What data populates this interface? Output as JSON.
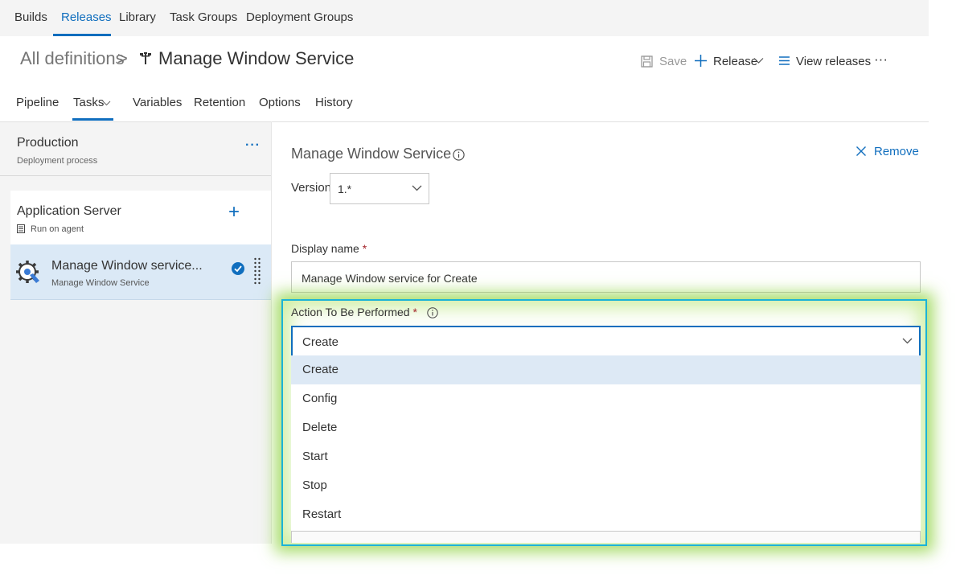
{
  "topnav": {
    "items": [
      "Builds",
      "Releases",
      "Library",
      "Task Groups",
      "Deployment Groups"
    ],
    "active": "Releases"
  },
  "breadcrumb": {
    "all": "All definitions",
    "separator": ">",
    "title": "Manage Window Service"
  },
  "actions": {
    "save": "Save",
    "release": "Release",
    "view_releases": "View releases",
    "more": "···"
  },
  "subtabs": {
    "items": [
      "Pipeline",
      "Tasks",
      "Variables",
      "Retention",
      "Options",
      "History"
    ],
    "active": "Tasks"
  },
  "left": {
    "environment": {
      "title": "Production",
      "subtitle": "Deployment process",
      "more": "···"
    },
    "phase": {
      "title": "Application Server",
      "subtitle": "Run on agent",
      "add": "+"
    },
    "task": {
      "title": "Manage Window service...",
      "subtitle": "Manage Window Service"
    }
  },
  "panel": {
    "title": "Manage Window Service",
    "remove": "Remove",
    "version_label": "Version",
    "version_value": "1.*",
    "display_name_label": "Display name",
    "required_mark": "*",
    "display_name_value": "Manage Window service for Create",
    "action_label": "Action To Be Performed",
    "action_value": "Create",
    "action_options": [
      "Create",
      "Config",
      "Delete",
      "Start",
      "Stop",
      "Restart"
    ]
  },
  "colors": {
    "accent": "#106ebe",
    "highlight_border": "#1bb3d7",
    "highlight_glow": "#8cd23c",
    "selected_option": "#dde9f5"
  }
}
